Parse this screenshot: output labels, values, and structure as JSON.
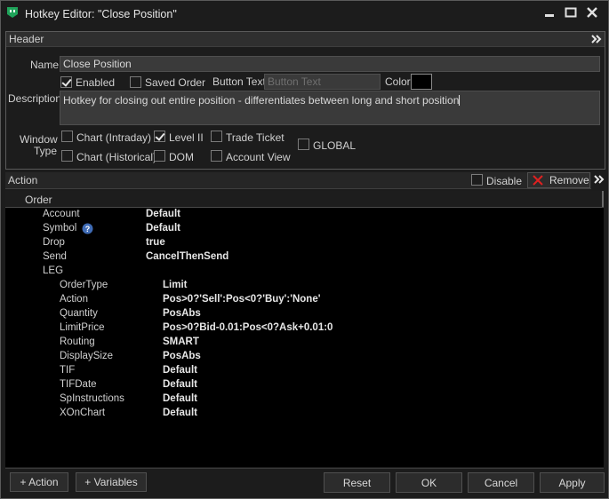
{
  "window": {
    "title": "Hotkey Editor: \"Close Position\""
  },
  "header_section": {
    "label": "Header"
  },
  "form": {
    "name_label": "Name",
    "name_value": "Close Position",
    "enabled_label": "Enabled",
    "enabled_checked": true,
    "saved_order_label": "Saved Order",
    "saved_order_checked": false,
    "button_text_label": "Button Text",
    "button_text_placeholder": "Button Text",
    "color_label": "Color",
    "color_value": "#000000",
    "description_label": "Description",
    "description_value": "Hotkey for closing out entire position - differentiates between long and short position",
    "window_type_label_1": "Window",
    "window_type_label_2": "Type",
    "window_types": [
      {
        "label": "Chart (Intraday)",
        "checked": false
      },
      {
        "label": "Level II",
        "checked": true
      },
      {
        "label": "Trade Ticket",
        "checked": false
      },
      {
        "label": "Chart (Historical)",
        "checked": false
      },
      {
        "label": "DOM",
        "checked": false
      },
      {
        "label": "Account View",
        "checked": false
      },
      {
        "label": "GLOBAL",
        "checked": false
      }
    ]
  },
  "action_section": {
    "label": "Action",
    "disable_label": "Disable",
    "remove_label": "Remove"
  },
  "tree": {
    "root": "Order",
    "order_fields": [
      {
        "key": "Account",
        "value": "Default"
      },
      {
        "key": "Symbol",
        "value": "Default"
      },
      {
        "key": "Drop",
        "value": "true"
      },
      {
        "key": "Send",
        "value": "CancelThenSend"
      },
      {
        "key": "LEG",
        "value": ""
      }
    ],
    "leg_fields": [
      {
        "key": "OrderType",
        "value": "Limit"
      },
      {
        "key": "Action",
        "value": "Pos>0?'Sell':Pos<0?'Buy':'None'"
      },
      {
        "key": "Quantity",
        "value": "PosAbs"
      },
      {
        "key": "LimitPrice",
        "value": "Pos>0?Bid-0.01:Pos<0?Ask+0.01:0"
      },
      {
        "key": "Routing",
        "value": "SMART"
      },
      {
        "key": "DisplaySize",
        "value": "PosAbs"
      },
      {
        "key": "TIF",
        "value": "Default"
      },
      {
        "key": "TIFDate",
        "value": "Default"
      },
      {
        "key": "SpInstructions",
        "value": "Default"
      },
      {
        "key": "XOnChart",
        "value": "Default"
      }
    ]
  },
  "footer": {
    "add_action": "+ Action",
    "add_variables": "+ Variables",
    "reset": "Reset",
    "ok": "OK",
    "cancel": "Cancel",
    "apply": "Apply"
  },
  "colors": {
    "accent_icon": "#1fa35a",
    "remove_x": "#e02020"
  }
}
